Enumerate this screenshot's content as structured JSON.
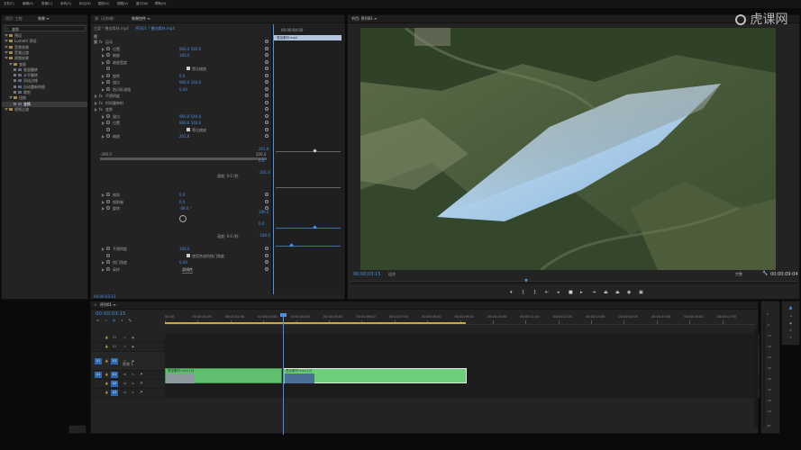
{
  "project_panel": {
    "tabs": [
      "项目: 工程",
      "效果 ≡"
    ],
    "search_placeholder": "变换",
    "items": [
      {
        "label": "预设",
        "level": 0
      },
      {
        "label": "Lumetri 预设",
        "level": 0
      },
      {
        "label": "音频效果",
        "level": 0
      },
      {
        "label": "音频过渡",
        "level": 0
      },
      {
        "label": "视频效果",
        "level": 0
      },
      {
        "label": "变换",
        "level": 1
      },
      {
        "label": "垂直翻转",
        "level": 2
      },
      {
        "label": "水平翻转",
        "level": 2
      },
      {
        "label": "羽化边缘",
        "level": 2
      },
      {
        "label": "自动重新构图",
        "level": 2
      },
      {
        "label": "裁剪",
        "level": 2
      },
      {
        "label": "扭曲",
        "level": 1
      },
      {
        "label": "变换",
        "level": 2,
        "selected": true
      },
      {
        "label": "视频过渡",
        "level": 0
      }
    ]
  },
  "effect_controls": {
    "tabs": [
      "源: (无剪辑)",
      "效果控件 ≡"
    ],
    "source_label": "主要 * 叠加素材.mp4",
    "sequence_label": "序列01 * 叠加素材.mp4",
    "section_video": "视频",
    "timecode_head": "00:00:04:00",
    "clip_tag": "叠加素材.mp4",
    "rows": [
      {
        "kind": "section",
        "label": "运动"
      },
      {
        "kind": "prop",
        "label": "位置",
        "value": "960.0    540.0"
      },
      {
        "kind": "prop",
        "label": "缩放",
        "value": "100.0"
      },
      {
        "kind": "prop",
        "label": "缩放宽度",
        "value": ""
      },
      {
        "kind": "check",
        "label": "等比缩放"
      },
      {
        "kind": "prop",
        "label": "旋转",
        "value": "0.0"
      },
      {
        "kind": "prop",
        "label": "锚点",
        "value": "960.0    540.0"
      },
      {
        "kind": "prop",
        "label": "防闪烁滤镜",
        "value": "0.00"
      },
      {
        "kind": "section",
        "label": "不透明度"
      },
      {
        "kind": "section",
        "label": "时间重映射"
      },
      {
        "kind": "section",
        "label": "变换"
      },
      {
        "kind": "prop",
        "label": "锚点",
        "value": "960.0    540.0"
      },
      {
        "kind": "prop",
        "label": "位置",
        "value": "960.0    540.0"
      },
      {
        "kind": "check",
        "label": "等比缩放"
      },
      {
        "kind": "prop",
        "label": "缩放",
        "value": "201.6"
      }
    ],
    "scale_min": "-200.0",
    "scale_max": "200.0",
    "graph_values_1": [
      "201.6",
      "0.0",
      "-201.6"
    ],
    "speed_label_1": "速度: 0.0 /秒",
    "rows2": [
      {
        "kind": "prop",
        "label": "倾斜",
        "value": "0.0"
      },
      {
        "kind": "prop",
        "label": "倾斜轴",
        "value": "0.0"
      },
      {
        "kind": "prop",
        "label": "旋转",
        "value": "-48.0 °"
      }
    ],
    "graph_values_2": [
      "180.0",
      "0.0",
      "-180.0"
    ],
    "speed_label_2": "速度: 0.0 /秒",
    "rows3": [
      {
        "kind": "prop",
        "label": "不透明度",
        "value": "100.0"
      },
      {
        "kind": "check",
        "label": "使用合成的快门角度"
      },
      {
        "kind": "prop",
        "label": "快门角度",
        "value": "0.00"
      },
      {
        "kind": "select",
        "label": "采样",
        "value": "双线性"
      }
    ],
    "footer_timecode": "00:00:03:13"
  },
  "program_monitor": {
    "title": "节目: 序列01 ≡",
    "timecode": "00:00:03:15",
    "fit": "适合",
    "quality": "完整",
    "duration": "00:00:09:04",
    "watermark": "虎课网"
  },
  "timeline": {
    "tab": "序列01 ≡",
    "timecode": "00:00:03:15",
    "ruler": [
      "00:00",
      "00:00:01:00",
      "00:00:02:00",
      "00:00:03:00",
      "00:00:04:00",
      "00:00:05:00",
      "00:00:06:00",
      "00:00:07:00",
      "00:00:08:00",
      "00:00:09:00",
      "00:00:10:00",
      "00:00:11:00",
      "00:00:12:00",
      "00:00:13:00",
      "00:00:14:00",
      "00:00:15:00",
      "00:00:16:00",
      "00:00:17:00"
    ],
    "video_tracks": [
      "V3",
      "V2",
      "V1"
    ],
    "audio_tracks": [
      "A1",
      "A2",
      "A3"
    ],
    "source_patches": [
      "V1",
      "A1"
    ],
    "clip1_label": "叠加素材.mp4 [V]",
    "clip2_label": "叠加素材.mp4 [V]",
    "track_label_v1": "视频 1",
    "meter_scale": [
      "0",
      "-6",
      "-12",
      "-18",
      "-24",
      "-30",
      "-36",
      "-42",
      "-48",
      "-54"
    ],
    "meter_unit": "dB"
  },
  "menu_bar": [
    "文件(F)",
    "编辑(E)",
    "剪辑(C)",
    "序列(S)",
    "标记(M)",
    "图形(G)",
    "视图(V)",
    "窗口(W)",
    "帮助(H)"
  ]
}
